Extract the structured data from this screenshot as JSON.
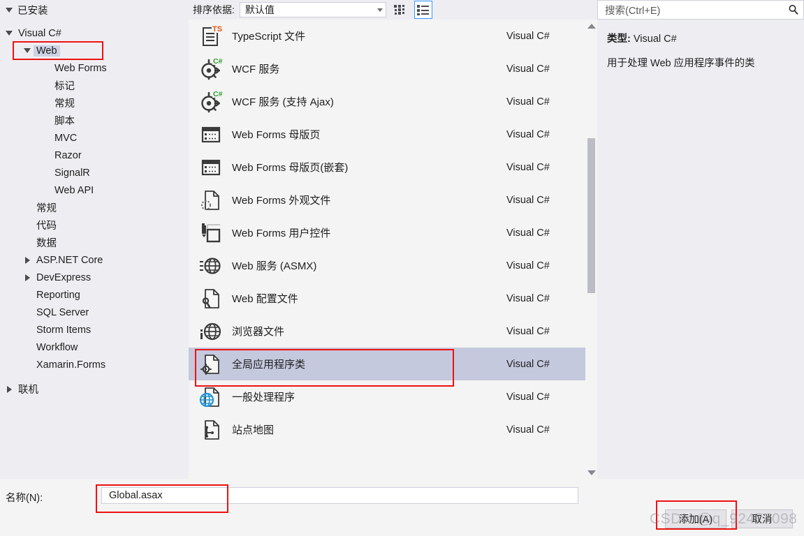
{
  "toolbar": {
    "installed_label": "已安装",
    "sort_label": "排序依据:",
    "sort_value": "默认值",
    "grid_view_name": "grid-view-icon",
    "list_view_name": "list-view-icon"
  },
  "search": {
    "placeholder": "搜索(Ctrl+E)",
    "value": "",
    "icon": "search-icon"
  },
  "sidebar": {
    "items": [
      {
        "label": "Visual C#",
        "indent": 0,
        "twisty": "down",
        "selected": false
      },
      {
        "label": "Web",
        "indent": 1,
        "twisty": "down",
        "selected": true
      },
      {
        "label": "Web Forms",
        "indent": 2,
        "twisty": "none",
        "selected": false
      },
      {
        "label": "标记",
        "indent": 2,
        "twisty": "none",
        "selected": false
      },
      {
        "label": "常规",
        "indent": 2,
        "twisty": "none",
        "selected": false
      },
      {
        "label": "脚本",
        "indent": 2,
        "twisty": "none",
        "selected": false
      },
      {
        "label": "MVC",
        "indent": 2,
        "twisty": "none",
        "selected": false
      },
      {
        "label": "Razor",
        "indent": 2,
        "twisty": "none",
        "selected": false
      },
      {
        "label": "SignalR",
        "indent": 2,
        "twisty": "none",
        "selected": false
      },
      {
        "label": "Web API",
        "indent": 2,
        "twisty": "none",
        "selected": false
      },
      {
        "label": "常规",
        "indent": 1,
        "twisty": "none",
        "selected": false
      },
      {
        "label": "代码",
        "indent": 1,
        "twisty": "none",
        "selected": false
      },
      {
        "label": "数据",
        "indent": 1,
        "twisty": "none",
        "selected": false
      },
      {
        "label": "ASP.NET Core",
        "indent": 1,
        "twisty": "right",
        "selected": false
      },
      {
        "label": "DevExpress",
        "indent": 1,
        "twisty": "right",
        "selected": false
      },
      {
        "label": "Reporting",
        "indent": 1,
        "twisty": "none",
        "selected": false
      },
      {
        "label": "SQL Server",
        "indent": 1,
        "twisty": "none",
        "selected": false
      },
      {
        "label": "Storm Items",
        "indent": 1,
        "twisty": "none",
        "selected": false
      },
      {
        "label": "Workflow",
        "indent": 1,
        "twisty": "none",
        "selected": false
      },
      {
        "label": "Xamarin.Forms",
        "indent": 1,
        "twisty": "none",
        "selected": false
      },
      {
        "label": "联机",
        "indent": 0,
        "twisty": "right",
        "selected": false
      }
    ]
  },
  "list": {
    "items": [
      {
        "name": "TypeScript 文件",
        "lang": "Visual C#",
        "icon": "typescript-file-icon",
        "selected": false
      },
      {
        "name": "WCF 服务",
        "lang": "Visual C#",
        "icon": "wcf-service-icon",
        "selected": false
      },
      {
        "name": "WCF 服务 (支持 Ajax)",
        "lang": "Visual C#",
        "icon": "wcf-service-ajax-icon",
        "selected": false
      },
      {
        "name": "Web Forms 母版页",
        "lang": "Visual C#",
        "icon": "master-page-icon",
        "selected": false
      },
      {
        "name": "Web Forms 母版页(嵌套)",
        "lang": "Visual C#",
        "icon": "nested-master-page-icon",
        "selected": false
      },
      {
        "name": "Web Forms 外观文件",
        "lang": "Visual C#",
        "icon": "skin-file-icon",
        "selected": false
      },
      {
        "name": "Web Forms 用户控件",
        "lang": "Visual C#",
        "icon": "user-control-icon",
        "selected": false
      },
      {
        "name": "Web 服务 (ASMX)",
        "lang": "Visual C#",
        "icon": "web-service-icon",
        "selected": false
      },
      {
        "name": "Web 配置文件",
        "lang": "Visual C#",
        "icon": "web-config-icon",
        "selected": false
      },
      {
        "name": "浏览器文件",
        "lang": "Visual C#",
        "icon": "browser-file-icon",
        "selected": false
      },
      {
        "name": "全局应用程序类",
        "lang": "Visual C#",
        "icon": "global-application-icon",
        "selected": true
      },
      {
        "name": "一般处理程序",
        "lang": "Visual C#",
        "icon": "generic-handler-icon",
        "selected": false
      },
      {
        "name": "站点地图",
        "lang": "Visual C#",
        "icon": "sitemap-icon",
        "selected": false
      }
    ]
  },
  "details": {
    "type_label": "类型:",
    "type_value": "Visual C#",
    "description": "用于处理 Web 应用程序事件的类"
  },
  "bottom": {
    "name_label": "名称(N):",
    "name_value": "Global.asax",
    "add_button": "添加(A)",
    "cancel_button": "取消"
  },
  "watermark": {
    "text": "CSDN @q_92477098"
  },
  "colors": {
    "annotation": "#ee1111",
    "selection": "#c5c9de",
    "tree_selection": "#cdd3e4",
    "panel_bg": "#eeeef2",
    "list_bg": "#f4f4f4",
    "accent_blue": "#3399ff"
  }
}
